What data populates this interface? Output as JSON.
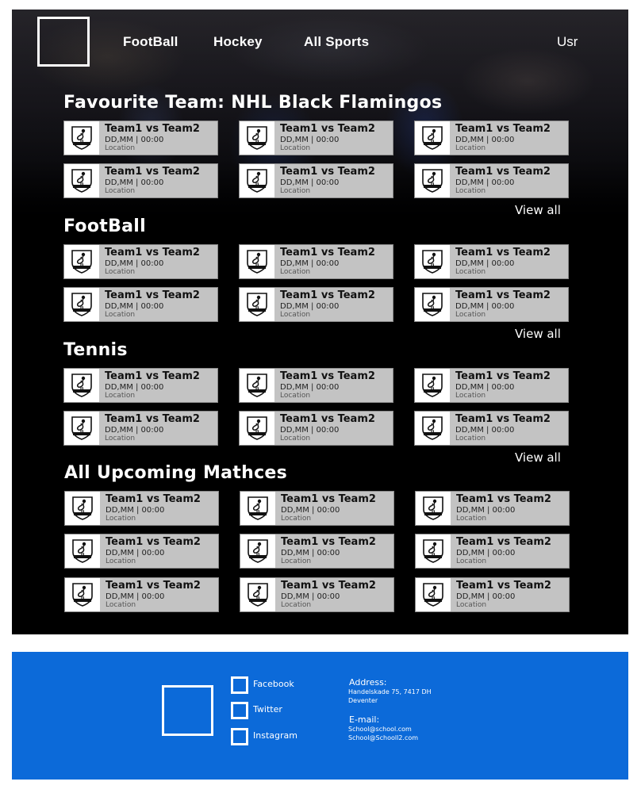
{
  "nav": {
    "items": [
      "FootBall",
      "Hockey",
      "All Sports"
    ],
    "user": "Usr"
  },
  "sections": [
    {
      "title": "Favourite Team: NHL Black Flamingos",
      "view_all": "View all",
      "cards": [
        {
          "title": "Team1 vs Team2",
          "date": "DD,MM | 00:00",
          "location": "Location"
        },
        {
          "title": "Team1 vs Team2",
          "date": "DD,MM | 00:00",
          "location": "Location"
        },
        {
          "title": "Team1 vs Team2",
          "date": "DD,MM | 00:00",
          "location": "Location"
        },
        {
          "title": "Team1 vs Team2",
          "date": "DD,MM | 00:00",
          "location": "Location"
        },
        {
          "title": "Team1 vs Team2",
          "date": "DD,MM | 00:00",
          "location": "Location"
        },
        {
          "title": "Team1 vs Team2",
          "date": "DD,MM | 00:00",
          "location": "Location"
        }
      ]
    },
    {
      "title": "FootBall",
      "view_all": "View all",
      "cards": [
        {
          "title": "Team1 vs Team2",
          "date": "DD,MM | 00:00",
          "location": "Location"
        },
        {
          "title": "Team1 vs Team2",
          "date": "DD,MM | 00:00",
          "location": "Location"
        },
        {
          "title": "Team1 vs Team2",
          "date": "DD,MM | 00:00",
          "location": "Location"
        },
        {
          "title": "Team1 vs Team2",
          "date": "DD,MM | 00:00",
          "location": "Location"
        },
        {
          "title": "Team1 vs Team2",
          "date": "DD,MM | 00:00",
          "location": "Location"
        },
        {
          "title": "Team1 vs Team2",
          "date": "DD,MM | 00:00",
          "location": "Location"
        }
      ]
    },
    {
      "title": "Tennis",
      "view_all": "View all",
      "cards": [
        {
          "title": "Team1 vs Team2",
          "date": "DD,MM | 00:00",
          "location": "Location"
        },
        {
          "title": "Team1 vs Team2",
          "date": "DD,MM | 00:00",
          "location": "Location"
        },
        {
          "title": "Team1 vs Team2",
          "date": "DD,MM | 00:00",
          "location": "Location"
        },
        {
          "title": "Team1 vs Team2",
          "date": "DD,MM | 00:00",
          "location": "Location"
        },
        {
          "title": "Team1 vs Team2",
          "date": "DD,MM | 00:00",
          "location": "Location"
        },
        {
          "title": "Team1 vs Team2",
          "date": "DD,MM | 00:00",
          "location": "Location"
        }
      ]
    },
    {
      "title": "All Upcoming Mathces",
      "cards": [
        {
          "title": "Team1 vs Team2",
          "date": "DD,MM | 00:00",
          "location": "Location"
        },
        {
          "title": "Team1 vs Team2",
          "date": "DD,MM | 00:00",
          "location": "Location"
        },
        {
          "title": "Team1 vs Team2",
          "date": "DD,MM | 00:00",
          "location": "Location"
        },
        {
          "title": "Team1 vs Team2",
          "date": "DD,MM | 00:00",
          "location": "Location"
        },
        {
          "title": "Team1 vs Team2",
          "date": "DD,MM | 00:00",
          "location": "Location"
        },
        {
          "title": "Team1 vs Team2",
          "date": "DD,MM | 00:00",
          "location": "Location"
        },
        {
          "title": "Team1 vs Team2",
          "date": "DD,MM | 00:00",
          "location": "Location"
        },
        {
          "title": "Team1 vs Team2",
          "date": "DD,MM | 00:00",
          "location": "Location"
        },
        {
          "title": "Team1 vs Team2",
          "date": "DD,MM | 00:00",
          "location": "Location"
        }
      ]
    }
  ],
  "card_icon": "flamingo-crest-icon",
  "footer": {
    "social": [
      "Facebook",
      "Twitter",
      "Instagram"
    ],
    "address_label": "Address:",
    "address_lines": [
      "Handelskade 75, 7417 DH",
      "Deventer"
    ],
    "email_label": "E-mail:",
    "email_lines": [
      "School@school.com",
      "School@Schooll2.com"
    ]
  },
  "colors": {
    "page_bg": "#000000",
    "card_bg": "#c3c3c3",
    "footer_bg": "#0c6ad9",
    "footer_top_strip": "#ffffff",
    "text_light": "#ffffff"
  }
}
